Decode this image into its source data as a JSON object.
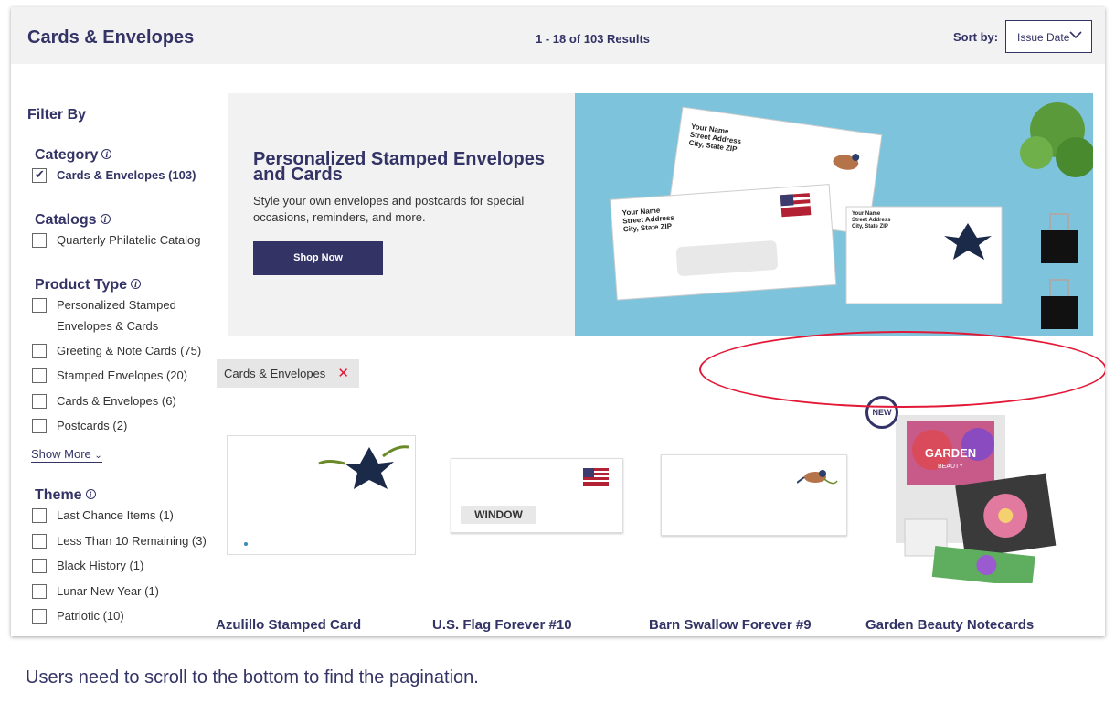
{
  "header": {
    "title": "Cards & Envelopes",
    "results": "1 - 18 of 103 Results",
    "sort_label": "Sort by:",
    "sort_value": "Issue Date"
  },
  "filters": {
    "title": "Filter By",
    "category": {
      "title": "Category",
      "options": [
        {
          "label": "Cards & Envelopes (103)",
          "checked": true
        }
      ]
    },
    "catalogs": {
      "title": "Catalogs",
      "options": [
        {
          "label": "Quarterly Philatelic Catalog",
          "checked": false
        }
      ]
    },
    "product_type": {
      "title": "Product Type",
      "options": [
        {
          "label": "Personalized Stamped Envelopes & Cards",
          "checked": false
        },
        {
          "label": "Greeting & Note Cards (75)",
          "checked": false
        },
        {
          "label": "Stamped Envelopes (20)",
          "checked": false
        },
        {
          "label": "Cards & Envelopes (6)",
          "checked": false
        },
        {
          "label": "Postcards (2)",
          "checked": false
        }
      ],
      "show_more": "Show More"
    },
    "theme": {
      "title": "Theme",
      "options": [
        {
          "label": "Last Chance Items (1)",
          "checked": false
        },
        {
          "label": "Less Than 10 Remaining (3)",
          "checked": false
        },
        {
          "label": "Black History (1)",
          "checked": false
        },
        {
          "label": "Lunar New Year (1)",
          "checked": false
        },
        {
          "label": "Patriotic (10)",
          "checked": false
        }
      ]
    }
  },
  "banner": {
    "title": "Personalized Stamped Envelopes and Cards",
    "description": "Style your own envelopes and postcards for special occasions, reminders, and more.",
    "button": "Shop Now",
    "env_back": {
      "l1": "Your Name",
      "l2": "Street Address",
      "l3": "City, State ZIP"
    },
    "env_front": {
      "l1": "Your Name",
      "l2": "Street Address",
      "l3": "City, State ZIP"
    },
    "card": {
      "l1": "Your Name",
      "l2": "Street Address",
      "l3": "City, State ZIP"
    }
  },
  "active_filter": {
    "label": "Cards & Envelopes",
    "remove_icon": "close-icon"
  },
  "products": [
    {
      "name": "Azulillo Stamped Card"
    },
    {
      "name": "U.S. Flag Forever #10",
      "window_label": "WINDOW"
    },
    {
      "name": "Barn Swallow Forever #9"
    },
    {
      "name": "Garden Beauty Notecards",
      "badge": "NEW",
      "box_title": "GARDEN",
      "box_sub": "BEAUTY"
    }
  ],
  "caption": "Users need to scroll to the bottom to find the pagination.",
  "colors": {
    "brand": "#333366",
    "accent_red": "#e31837",
    "banner_blue": "#7ec3dc"
  }
}
